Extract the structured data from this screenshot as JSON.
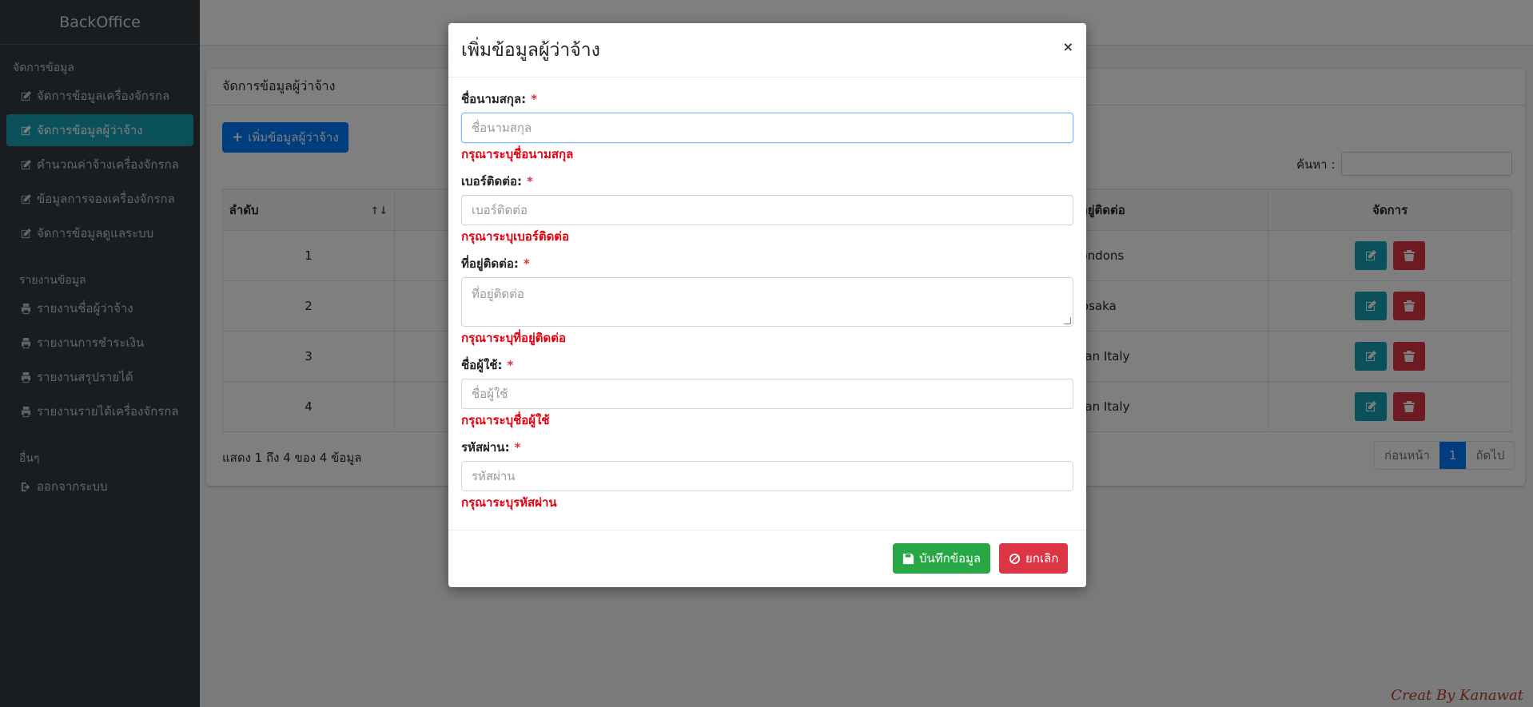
{
  "app": {
    "brand": "BackOffice"
  },
  "sidebar": {
    "section1": "จัดการข้อมูล",
    "items1": [
      {
        "label": "จัดการข้อมูลเครื่องจักรกล"
      },
      {
        "label": "จัดการข้อมูลผู้ว่าจ้าง"
      },
      {
        "label": "คำนวณค่าจ้างเครื่องจักรกล"
      },
      {
        "label": "ข้อมูลการจองเครื่องจักรกล"
      },
      {
        "label": "จัดการข้อมูลดูแลระบบ"
      }
    ],
    "section2": "รายงานข้อมูล",
    "items2": [
      {
        "label": "รายงานชื่อผู้ว่าจ้าง"
      },
      {
        "label": "รายงานการชำระเงิน"
      },
      {
        "label": "รายงานสรุปรายได้"
      },
      {
        "label": "รายงานรายได้เครื่องจักรกล"
      }
    ],
    "section3": "อื่นๆ",
    "logout": "ออกจากระบบ"
  },
  "card": {
    "title": "จัดการข้อมูลผู้ว่าจ้าง",
    "add_button": "เพิ่มข้อมูลผู้ว่าจ้าง",
    "search_label": "ค้นหา :",
    "columns": [
      "ลำดับ",
      "ที่อยู่ติดต่อ",
      "จัดการ"
    ],
    "rows": [
      {
        "no": "1",
        "address": "Londons"
      },
      {
        "no": "2",
        "address": "osaka"
      },
      {
        "no": "3",
        "address": "Milan Italy"
      },
      {
        "no": "4",
        "address": "Milan Italy"
      }
    ],
    "info": "แสดง 1 ถึง 4 ของ 4 ข้อมูล",
    "pager": {
      "prev": "ก่อนหน้า",
      "current": "1",
      "next": "ถัดไป"
    }
  },
  "credit": "Creat By Kanawat",
  "modal": {
    "title": "เพิ่มข้อมูลผู้ว่าจ้าง",
    "close": "×",
    "fields": [
      {
        "label": "ชื่อนามสกุล:",
        "placeholder": "ชื่อนามสกุล",
        "error": "กรุณาระบุชื่อนามสกุล"
      },
      {
        "label": "เบอร์ติดต่อ:",
        "placeholder": "เบอร์ติดต่อ",
        "error": "กรุณาระบุเบอร์ติดต่อ"
      },
      {
        "label": "ที่อยู่ติดต่อ:",
        "placeholder": "ที่อยู่ติดต่อ",
        "error": "กรุณาระบุที่อยู่ติดต่อ"
      },
      {
        "label": "ชื่อผู้ใช้:",
        "placeholder": "ชื่อผู้ใช้",
        "error": "กรุณาระบุชื่อผู้ใช้"
      },
      {
        "label": "รหัสผ่าน:",
        "placeholder": "รหัสผ่าน",
        "error": "กรุณาระบุรหัสผ่าน"
      }
    ],
    "required_mark": "*",
    "save_button": "บันทึกข้อมูล",
    "cancel_button": "ยกเลิก"
  },
  "icons": {
    "edit": "edit-icon",
    "print": "print-icon",
    "trash": "trash-icon",
    "save": "save-icon",
    "ban": "ban-icon",
    "logout": "sign-out-icon",
    "plus": "plus-icon"
  },
  "colors": {
    "sidebar_bg": "#343a40",
    "active": "#17a2b8",
    "primary": "#007bff",
    "success": "#28a745",
    "danger": "#dc3545",
    "error_text": "#e3000f"
  }
}
